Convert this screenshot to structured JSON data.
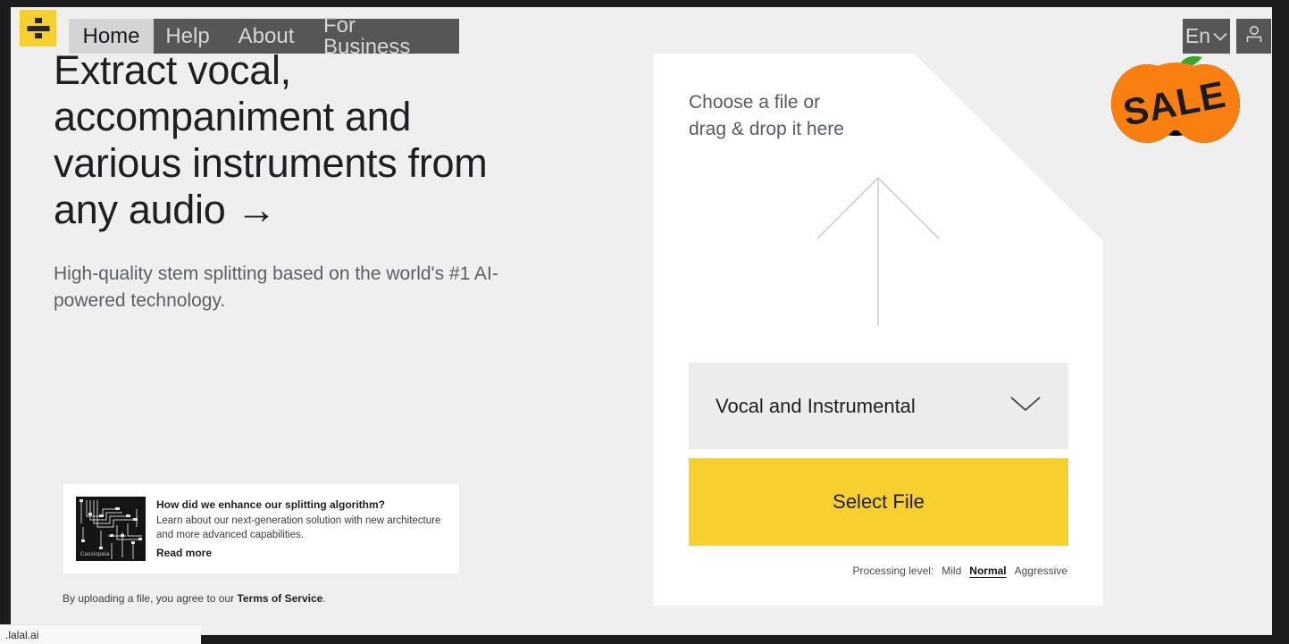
{
  "nav": {
    "logo_icon": "divide-logo-icon",
    "tabs": [
      {
        "label": "Home",
        "active": true
      },
      {
        "label": "Help",
        "active": false
      },
      {
        "label": "About",
        "active": false
      },
      {
        "label": "For Business",
        "active": false
      }
    ],
    "language": "En",
    "language_caret_icon": "chevron-down-icon",
    "account_icon": "user-icon"
  },
  "hero": {
    "title": "Extract vocal, accompaniment and various instruments from any audio →",
    "subtitle": "High-quality stem splitting based on the world's #1 AI-powered technology."
  },
  "promo": {
    "thumb_caption": "Cassiopeia",
    "title": "How did we enhance our splitting algorithm?",
    "description": "Learn about our next-generation solution with new architecture and more advanced capabilities.",
    "read_more": "Read more"
  },
  "terms": {
    "text": "By uploading a file, you agree to our ",
    "link": "Terms of Service",
    "period": "."
  },
  "upload": {
    "prompt": "Choose a file or\ndrag & drop it here",
    "arrow_icon": "upload-arrow-icon",
    "stem_selection": "Vocal and Instrumental",
    "stem_caret_icon": "chevron-down-icon",
    "select_file_label": "Select File",
    "processing_level_label": "Processing level:",
    "processing_levels": [
      {
        "label": "Mild",
        "selected": false
      },
      {
        "label": "Normal",
        "selected": true
      },
      {
        "label": "Aggressive",
        "selected": false
      }
    ]
  },
  "sale_badge": {
    "text": "SALE",
    "icon": "pumpkin-icon",
    "pumpkin_color": "#f98010",
    "stem_color": "#3aa526"
  },
  "status_bar": {
    "url": ".lalal.ai"
  },
  "colors": {
    "brand_yellow": "#f7cf2e",
    "nav_dark": "#565659",
    "nav_active": "#d2d4d5",
    "page_bg": "#efefef",
    "chrome_dark": "#1c1c1e"
  }
}
